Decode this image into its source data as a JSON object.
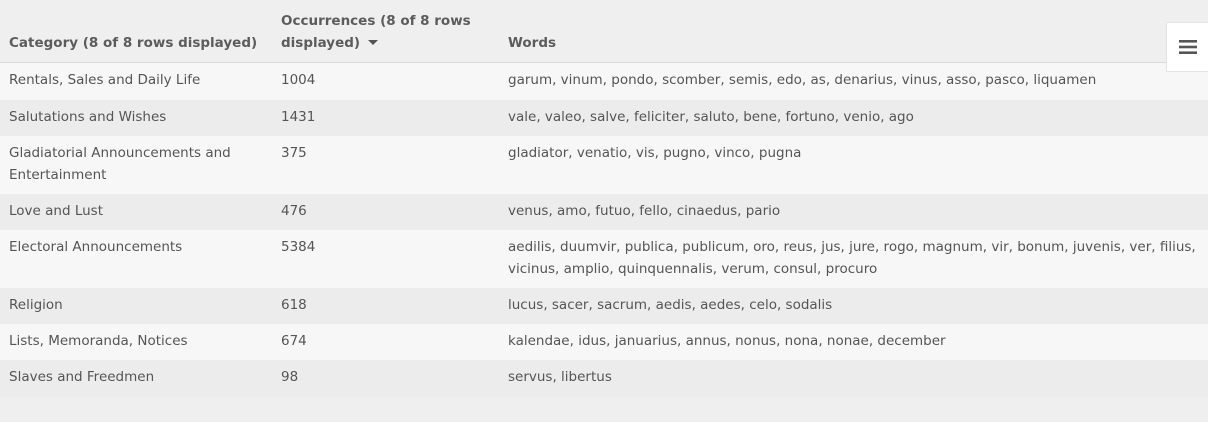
{
  "table": {
    "headers": {
      "category": "Category (8 of 8 rows displayed)",
      "occurrences": "Occurrences (8 of 8 rows displayed)",
      "words": "Words"
    },
    "sort": {
      "column": "occurrences",
      "direction": "descending"
    },
    "rows": [
      {
        "category": "Rentals, Sales and Daily Life",
        "occurrences": "1004",
        "words": "garum, vinum, pondo, scomber, semis, edo, as, denarius, vinus, asso, pasco, liquamen"
      },
      {
        "category": "Salutations and Wishes",
        "occurrences": "1431",
        "words": "vale, valeo, salve, feliciter, saluto, bene, fortuno, venio, ago"
      },
      {
        "category": "Gladiatorial Announcements and Entertainment",
        "occurrences": "375",
        "words": "gladiator, venatio, vis, pugno, vinco, pugna"
      },
      {
        "category": "Love and Lust",
        "occurrences": "476",
        "words": "venus, amo, futuo, fello, cinaedus, pario"
      },
      {
        "category": "Electoral Announcements",
        "occurrences": "5384",
        "words": "aedilis, duumvir, publica, publicum, oro, reus, jus, jure, rogo, magnum, vir, bonum, juvenis, ver, filius, vicinus, amplio, quinquennalis, verum, consul, procuro"
      },
      {
        "category": "Religion",
        "occurrences": "618",
        "words": "lucus, sacer, sacrum, aedis, aedes, celo, sodalis"
      },
      {
        "category": "Lists, Memoranda, Notices",
        "occurrences": "674",
        "words": "kalendae, idus, januarius, annus, nonus, nona, nonae, december"
      },
      {
        "category": "Slaves and Freedmen",
        "occurrences": "98",
        "words": "servus, libertus"
      }
    ]
  },
  "toolbar": {
    "menu_icon": "hamburger-menu-icon"
  }
}
